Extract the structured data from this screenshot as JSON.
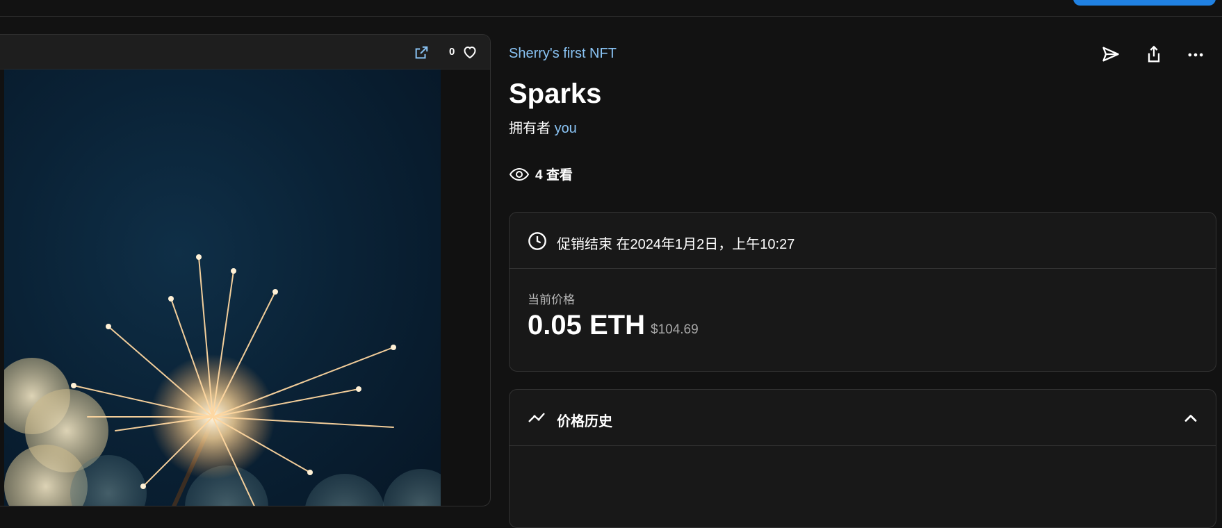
{
  "item": {
    "collection_name": "Sherry's first NFT",
    "title": "Sparks",
    "owner_prefix": "拥有者",
    "owner_name": "you",
    "views_text": "4 查看",
    "like_count": "0"
  },
  "sale": {
    "end_text": "促销结束 在2024年1月2日，上午10:27",
    "price_label": "当前价格",
    "price_eth": "0.05 ETH",
    "price_usd": "$104.69"
  },
  "history": {
    "title": "价格历史"
  },
  "colors": {
    "background": "#121212",
    "link": "#8ac4f5",
    "accent": "#2081e2",
    "card": "#181818",
    "border": "#333333"
  },
  "icons": {
    "open_link": "open-in-new-icon",
    "like": "heart-icon",
    "send": "send-icon",
    "share": "share-icon",
    "more": "more-horizontal-icon",
    "views": "eye-icon",
    "time": "clock-icon",
    "history": "trending-icon",
    "collapse": "chevron-up-icon"
  }
}
